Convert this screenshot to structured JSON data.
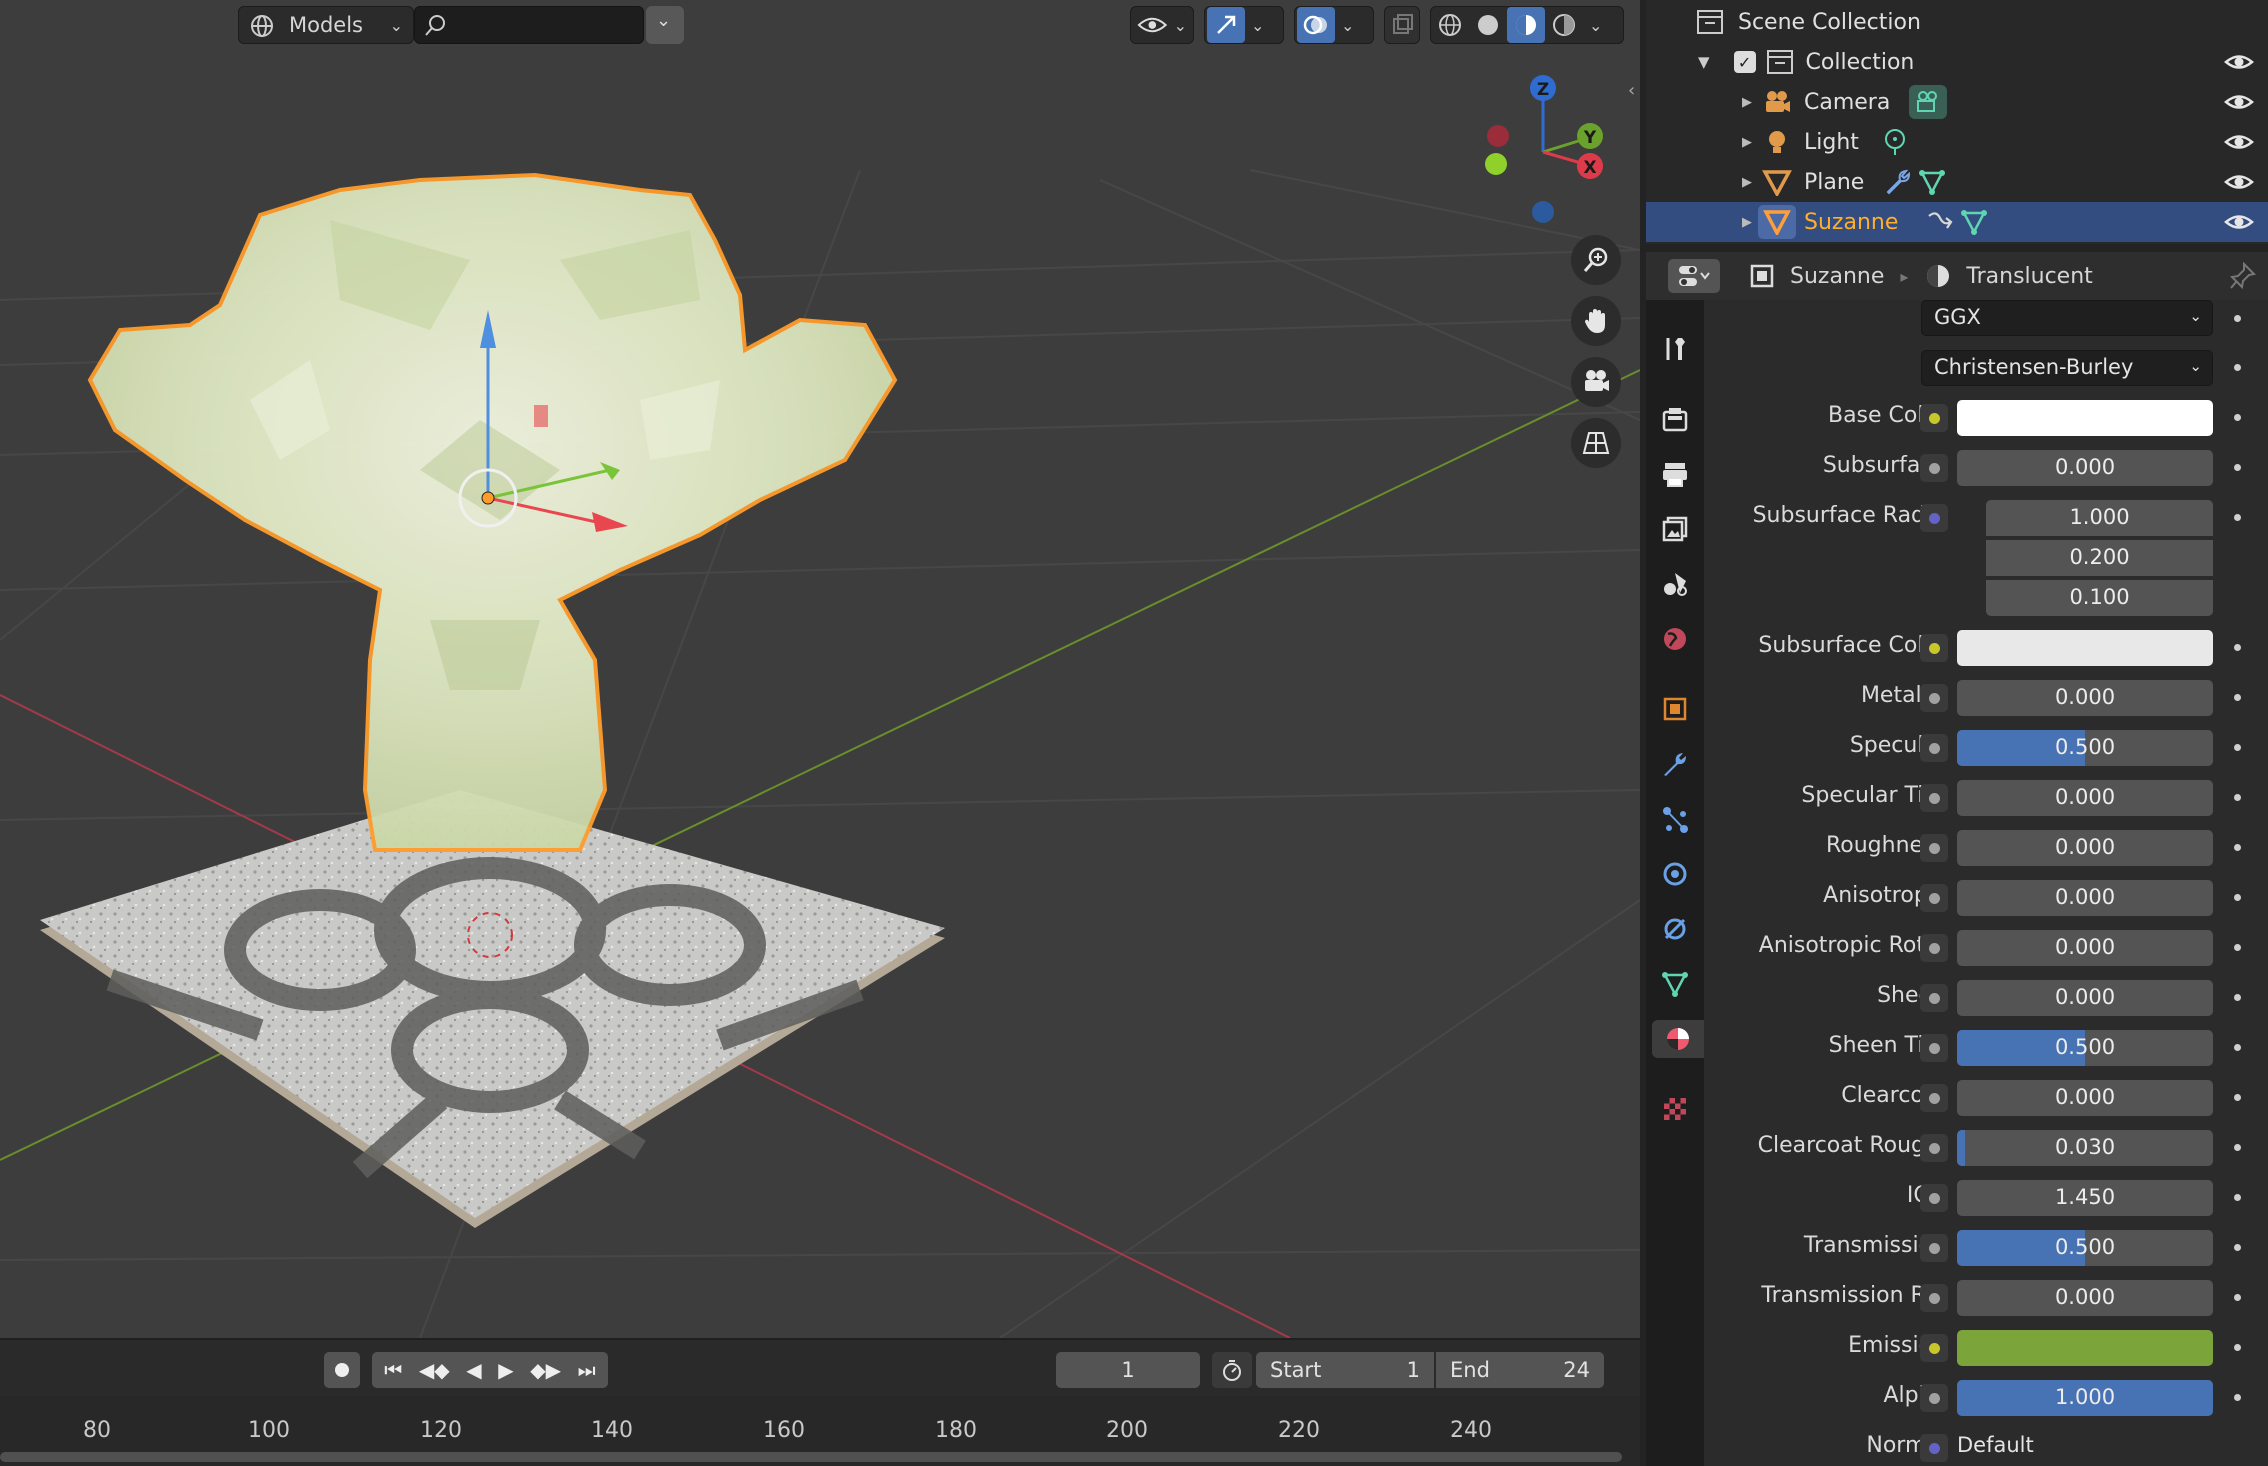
{
  "viewport": {
    "mode_label": "Models",
    "search_placeholder": ""
  },
  "outliner": {
    "root": "Scene Collection",
    "collection": "Collection",
    "objects": [
      {
        "name": "Camera",
        "icon": "camera-icon",
        "color": "#e09a4a"
      },
      {
        "name": "Light",
        "icon": "light-icon",
        "color": "#e09a4a"
      },
      {
        "name": "Plane",
        "icon": "mesh-icon",
        "color": "#e09a4a"
      },
      {
        "name": "Suzanne",
        "icon": "mesh-icon",
        "color": "#e09a4a",
        "selected": true
      }
    ]
  },
  "properties": {
    "object_name": "Suzanne",
    "material_name": "Translucent",
    "distribution": "GGX",
    "subsurface_method": "Christensen-Burley",
    "rows": [
      {
        "label": "Base Color",
        "socket": "yellow",
        "kind": "color",
        "color": "#ffffff"
      },
      {
        "label": "Subsurface",
        "socket": "grey",
        "kind": "value",
        "value": "0.000",
        "fill": 0
      },
      {
        "label": "Subsurface Rad...",
        "socket": "blue",
        "kind": "vector",
        "values": [
          "1.000",
          "0.200",
          "0.100"
        ]
      },
      {
        "label": "Subsurface Color",
        "socket": "yellow",
        "kind": "color",
        "color": "#e8e8e8"
      },
      {
        "label": "Metallic",
        "socket": "grey",
        "kind": "value",
        "value": "0.000",
        "fill": 0
      },
      {
        "label": "Specular",
        "socket": "grey",
        "kind": "value",
        "value": "0.500",
        "fill": 0.5
      },
      {
        "label": "Specular Tint",
        "socket": "grey",
        "kind": "value",
        "value": "0.000",
        "fill": 0
      },
      {
        "label": "Roughness",
        "socket": "grey",
        "kind": "value",
        "value": "0.000",
        "fill": 0
      },
      {
        "label": "Anisotropic",
        "socket": "grey",
        "kind": "value",
        "value": "0.000",
        "fill": 0
      },
      {
        "label": "Anisotropic Rot...",
        "socket": "grey",
        "kind": "value",
        "value": "0.000",
        "fill": 0
      },
      {
        "label": "Sheen",
        "socket": "grey",
        "kind": "value",
        "value": "0.000",
        "fill": 0
      },
      {
        "label": "Sheen Tint",
        "socket": "grey",
        "kind": "value",
        "value": "0.500",
        "fill": 0.5
      },
      {
        "label": "Clearcoat",
        "socket": "grey",
        "kind": "value",
        "value": "0.000",
        "fill": 0
      },
      {
        "label": "Clearcoat Roug...",
        "socket": "grey",
        "kind": "value",
        "value": "0.030",
        "fill": 0.03
      },
      {
        "label": "IOR",
        "socket": "grey",
        "kind": "value",
        "value": "1.450",
        "fill": 0
      },
      {
        "label": "Transmission",
        "socket": "grey",
        "kind": "value",
        "value": "0.500",
        "fill": 0.5
      },
      {
        "label": "Transmission R...",
        "socket": "grey",
        "kind": "value",
        "value": "0.000",
        "fill": 0
      },
      {
        "label": "Emission",
        "socket": "yellow",
        "kind": "color",
        "color": "#7ba43a"
      },
      {
        "label": "Alpha",
        "socket": "grey",
        "kind": "value",
        "value": "1.000",
        "fill": 1
      },
      {
        "label": "Normal",
        "socket": "blue",
        "kind": "text",
        "value": "Default"
      }
    ]
  },
  "timeline": {
    "current_frame": "1",
    "start_label": "Start",
    "start_value": "1",
    "end_label": "End",
    "end_value": "24",
    "ticks": [
      "80",
      "100",
      "120",
      "140",
      "160",
      "180",
      "200",
      "220",
      "240"
    ]
  },
  "gizmo": {
    "z": "Z",
    "y": "Y",
    "x": "X"
  },
  "colors": {
    "accent": "#4772b3",
    "selected_text": "#ffaf29",
    "outline": "#ff9c29"
  }
}
